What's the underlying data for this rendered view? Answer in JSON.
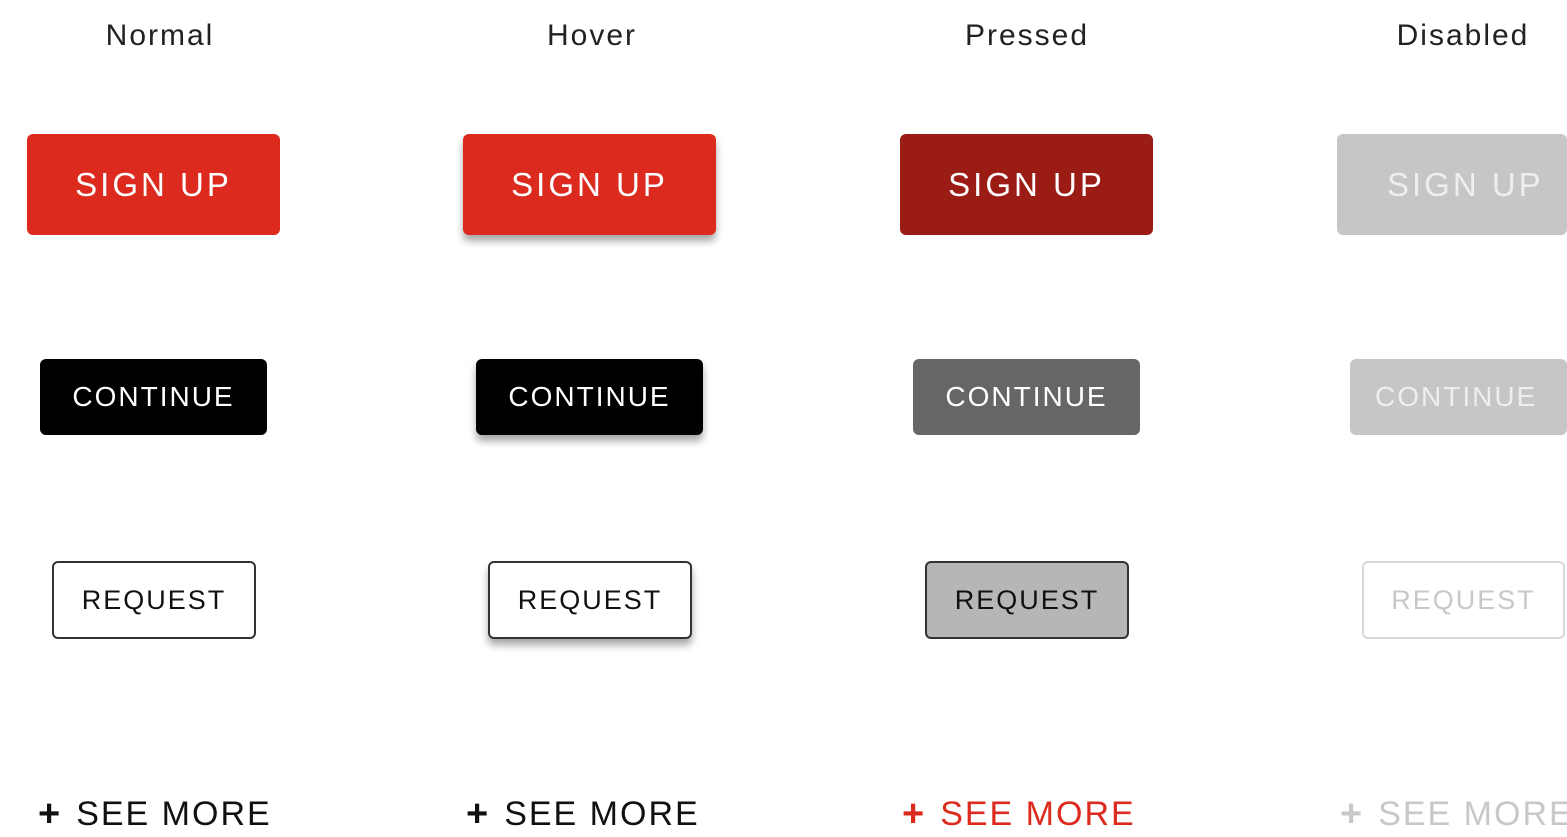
{
  "columns": [
    {
      "state": "Normal"
    },
    {
      "state": "Hover"
    },
    {
      "state": "Pressed"
    },
    {
      "state": "Disabled"
    }
  ],
  "buttons": {
    "signup_label": "SIGN UP",
    "continue_label": "CONTINUE",
    "request_label": "REQUEST",
    "seemore_label": "SEE MORE",
    "seemore_icon": "plus-icon"
  },
  "colors": {
    "primary_red": "#dc2a1e",
    "pressed_red": "#9b1b15",
    "black": "#000000",
    "pressed_gray": "#666666",
    "request_pressed_fill": "#b6b6b6",
    "disabled_gray": "#c6c6c6"
  }
}
